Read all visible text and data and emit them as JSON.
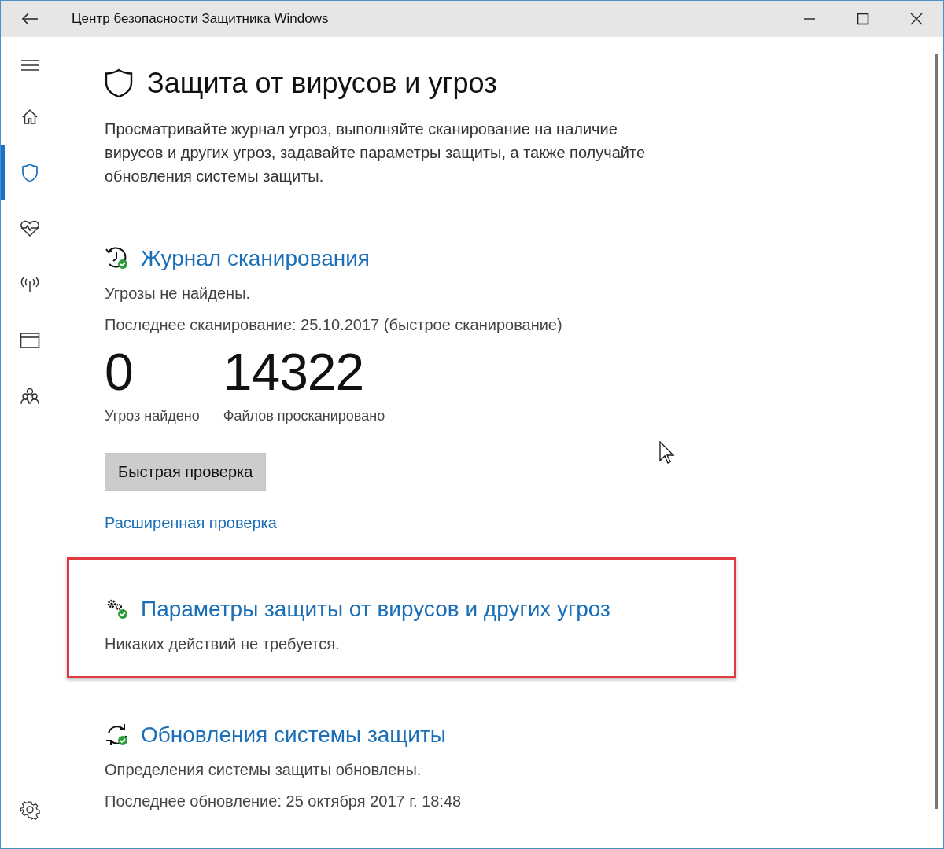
{
  "window": {
    "title": "Центр безопасности Защитника Windows"
  },
  "sidebar": {
    "items": [
      {
        "kind": "home",
        "selected": false
      },
      {
        "kind": "shield",
        "selected": true
      },
      {
        "kind": "health",
        "selected": false
      },
      {
        "kind": "network",
        "selected": false
      },
      {
        "kind": "browser",
        "selected": false
      },
      {
        "kind": "family",
        "selected": false
      }
    ]
  },
  "page": {
    "title": "Защита от вирусов и угроз",
    "description": "Просматривайте журнал угроз, выполняйте сканирование на наличие вирусов и других угроз, задавайте параметры защиты, а также получайте обновления системы защиты."
  },
  "sections": [
    {
      "kind": "history",
      "title": "Журнал сканирования",
      "highlighted": false,
      "lines": [
        "Угрозы не найдены.",
        "Последнее сканирование: 25.10.2017 (быстрое сканирование)"
      ],
      "stats": [
        {
          "value": "0",
          "label": "Угроз найдено"
        },
        {
          "value": "14322",
          "label": "Файлов просканировано"
        }
      ],
      "button": "Быстрая проверка",
      "link": "Расширенная проверка"
    },
    {
      "kind": "settings",
      "title": "Параметры защиты от вирусов и других угроз",
      "highlighted": true,
      "lines": [
        "Никаких действий не требуется."
      ]
    },
    {
      "kind": "update",
      "title": "Обновления системы защиты",
      "highlighted": false,
      "lines": [
        "Определения системы защиты обновлены.",
        "Последнее обновление: 25 октября 2017 г. 18:48"
      ]
    }
  ]
}
